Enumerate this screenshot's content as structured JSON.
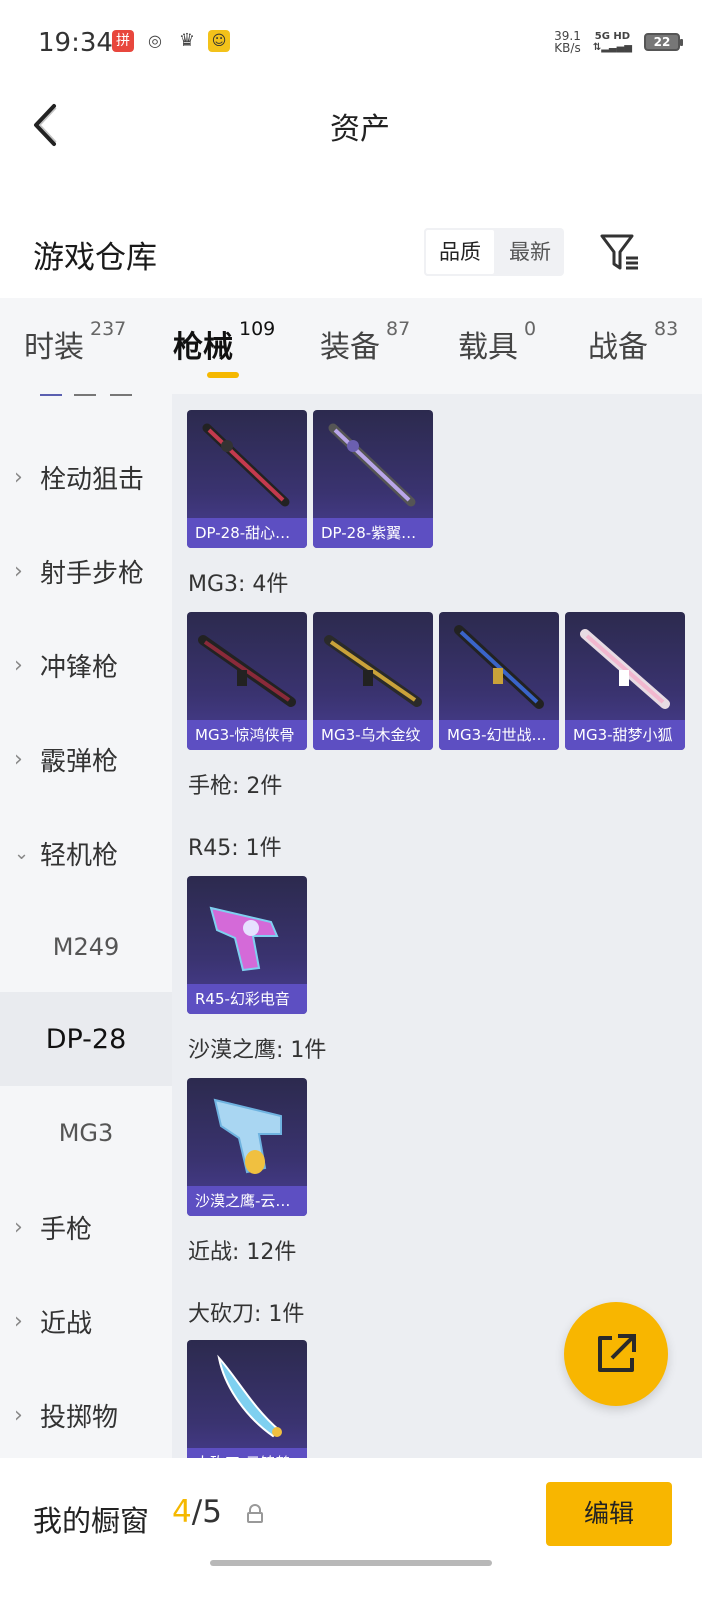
{
  "status_bar": {
    "time": "19:34",
    "net_speed_value": "39.1",
    "net_speed_unit": "KB/s",
    "signal_label": "5G HD",
    "battery": "22"
  },
  "header": {
    "title": "资产"
  },
  "warehouse": {
    "title": "游戏仓库",
    "sort_quality": "品质",
    "sort_newest": "最新"
  },
  "tabs": [
    {
      "label": "时装",
      "count": "237"
    },
    {
      "label": "枪械",
      "count": "109"
    },
    {
      "label": "装备",
      "count": "87"
    },
    {
      "label": "载具",
      "count": "0"
    },
    {
      "label": "战备",
      "count": "83"
    }
  ],
  "sidebar": {
    "items": [
      {
        "label": "栓动狙击"
      },
      {
        "label": "射手步枪"
      },
      {
        "label": "冲锋枪"
      },
      {
        "label": "霰弹枪"
      },
      {
        "label": "轻机枪"
      },
      {
        "label": "M249"
      },
      {
        "label": "DP-28"
      },
      {
        "label": "MG3"
      },
      {
        "label": "手枪"
      },
      {
        "label": "近战"
      },
      {
        "label": "投掷物"
      }
    ]
  },
  "content": {
    "dp28_cards": [
      {
        "name": "DP-28-甜心…",
        "color": "#c43a4e"
      },
      {
        "name": "DP-28-紫翼…",
        "color": "#b9a6e8"
      }
    ],
    "mg3_label": "MG3: 4件",
    "mg3_cards": [
      {
        "name": "MG3-惊鸿侠骨",
        "color": "#8a2a3a"
      },
      {
        "name": "MG3-乌木金纹",
        "color": "#c9a23a"
      },
      {
        "name": "MG3-幻世战…",
        "color": "#3a64c8"
      },
      {
        "name": "MG3-甜梦小狐",
        "color": "#f2b7cf"
      }
    ],
    "pistol_label": "手枪: 2件",
    "r45_label": "R45: 1件",
    "r45_cards": [
      {
        "name": "R45-幻彩电音",
        "color": "#d46ad8"
      }
    ],
    "deagle_label": "沙漠之鹰: 1件",
    "deagle_cards": [
      {
        "name": "沙漠之鹰-云…",
        "color": "#f0c040"
      }
    ],
    "melee_label": "近战: 12件",
    "machete_label": "大砍刀: 1件",
    "machete_cards": [
      {
        "name": "大砍刀-云锦鹤",
        "color": "#7fd0f0"
      }
    ]
  },
  "bottom": {
    "label": "我的橱窗",
    "count_current": "4",
    "count_separator": "/",
    "count_total": "5",
    "edit_label": "编辑"
  }
}
